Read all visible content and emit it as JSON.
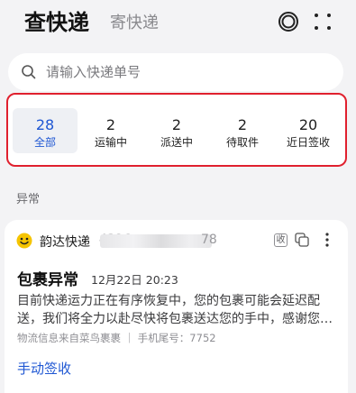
{
  "header": {
    "title": "查快递",
    "subtitle_tab": "寄快递",
    "ring_icon": "ring-icon",
    "menu_icon": "dots-grid-icon"
  },
  "search": {
    "placeholder": "请输入快递单号",
    "icon": "search-icon"
  },
  "stats": [
    {
      "count": "28",
      "label": "全部",
      "active": true
    },
    {
      "count": "2",
      "label": "运输中",
      "active": false
    },
    {
      "count": "2",
      "label": "派送中",
      "active": false
    },
    {
      "count": "2",
      "label": "待取件",
      "active": false
    },
    {
      "count": "20",
      "label": "近日签收",
      "active": false
    }
  ],
  "highlight_color": "#e0202e",
  "accent_color": "#1f57d3",
  "section_label": "异常",
  "package": {
    "courier": "韵达快递",
    "courier_logo": "smiley-logo-icon",
    "tracking_number": "4326",
    "tracking_number_tail": "78",
    "sign_badge": "收",
    "status_title": "包裹异常",
    "status_time": "12月22日 20:23",
    "description": "目前快递运力正在有序恢复中，您的包裹可能会延迟配送，我们将全力以赴尽快将包裹送达您的手中，感谢您的耐心等待。",
    "source": "物流信息来自菜鸟裹裹 ｜ 手机尾号：7752",
    "action": "手动签收"
  }
}
